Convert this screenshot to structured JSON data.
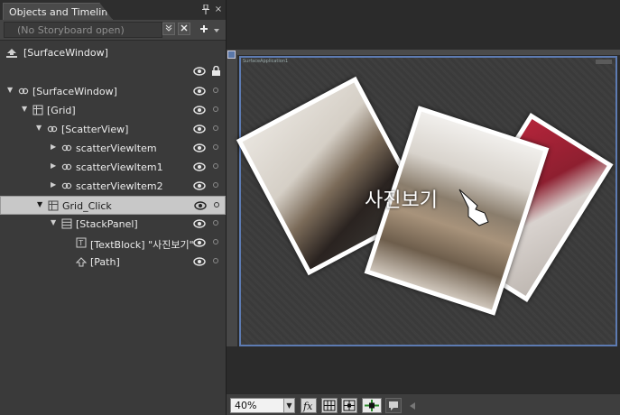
{
  "panel": {
    "tab_title": "Objects and Timeline",
    "storyboard_placeholder": "(No Storyboard open)",
    "root_label": "[SurfaceWindow]"
  },
  "tree": [
    {
      "name": "tree-item-surfacewindow",
      "label": "[SurfaceWindow]",
      "indent": 0,
      "twisty": "open",
      "icon": "surfacewindow-icon",
      "selected": false
    },
    {
      "name": "tree-item-grid",
      "label": "[Grid]",
      "indent": 1,
      "twisty": "open",
      "icon": "grid-icon",
      "selected": false
    },
    {
      "name": "tree-item-scatterview",
      "label": "[ScatterView]",
      "indent": 2,
      "twisty": "open",
      "icon": "scatterview-icon",
      "selected": false
    },
    {
      "name": "tree-item-scatterviewitem",
      "label": "scatterViewItem",
      "indent": 3,
      "twisty": "closed",
      "icon": "scatterview-icon",
      "selected": false
    },
    {
      "name": "tree-item-scatterviewitem1",
      "label": "scatterViewItem1",
      "indent": 3,
      "twisty": "closed",
      "icon": "scatterview-icon",
      "selected": false
    },
    {
      "name": "tree-item-scatterviewitem2",
      "label": "scatterViewItem2",
      "indent": 3,
      "twisty": "closed",
      "icon": "scatterview-icon",
      "selected": false
    },
    {
      "name": "tree-item-grid-click",
      "label": "Grid_Click",
      "indent": 2,
      "twisty": "open",
      "icon": "grid-icon",
      "selected": true
    },
    {
      "name": "tree-item-stackpanel",
      "label": "[StackPanel]",
      "indent": 3,
      "twisty": "open",
      "icon": "stackpanel-icon",
      "selected": false
    },
    {
      "name": "tree-item-textblock",
      "label": "[TextBlock] \"사진보기\"",
      "indent": 4,
      "twisty": "none",
      "icon": "textblock-icon",
      "selected": false
    },
    {
      "name": "tree-item-path",
      "label": "[Path]",
      "indent": 4,
      "twisty": "none",
      "icon": "path-icon",
      "selected": false
    }
  ],
  "canvas": {
    "surface_title": "SurfaceApplication1",
    "overlay_text": "사진보기"
  },
  "toolbar": {
    "zoom_value": "40%"
  },
  "colors": {
    "surface_border": "#5d7bb2",
    "selected_row": "#c8c8c8"
  }
}
